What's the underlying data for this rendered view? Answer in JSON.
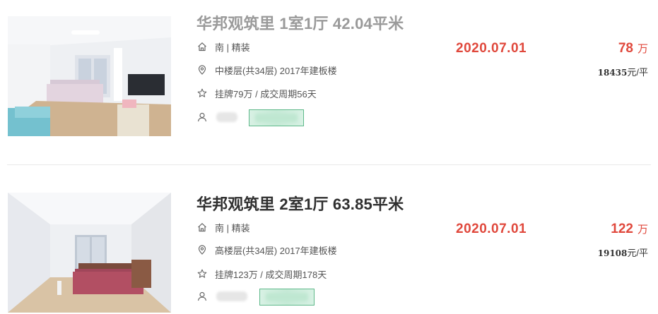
{
  "listings": [
    {
      "title": "华邦观筑里 1室1厅 42.04平米",
      "orientation": "南 | 精装",
      "floor_info": "中楼层(共34层) 2017年建板楼",
      "listing_info": "挂牌79万 / 成交周期56天",
      "deal_date": "2020.07.01",
      "total_price": "78",
      "price_unit": "万",
      "unit_price_value": "18435",
      "unit_price_suffix": "元/平"
    },
    {
      "title": "华邦观筑里 2室1厅 63.85平米",
      "orientation": "南 | 精装",
      "floor_info": "高楼层(共34层) 2017年建板楼",
      "listing_info": "挂牌123万 / 成交周期178天",
      "deal_date": "2020.07.01",
      "total_price": "122",
      "price_unit": "万",
      "unit_price_value": "19108",
      "unit_price_suffix": "元/平"
    }
  ],
  "icons": {
    "orientation": "house-icon",
    "floor": "location-pin-icon",
    "listing": "star-icon",
    "agent": "person-icon"
  },
  "colors": {
    "accent_red": "#e0483c",
    "title_sold_gray": "#9a9a9a",
    "title_dark": "#2f2f2f",
    "badge_green": "#5fb98a"
  }
}
